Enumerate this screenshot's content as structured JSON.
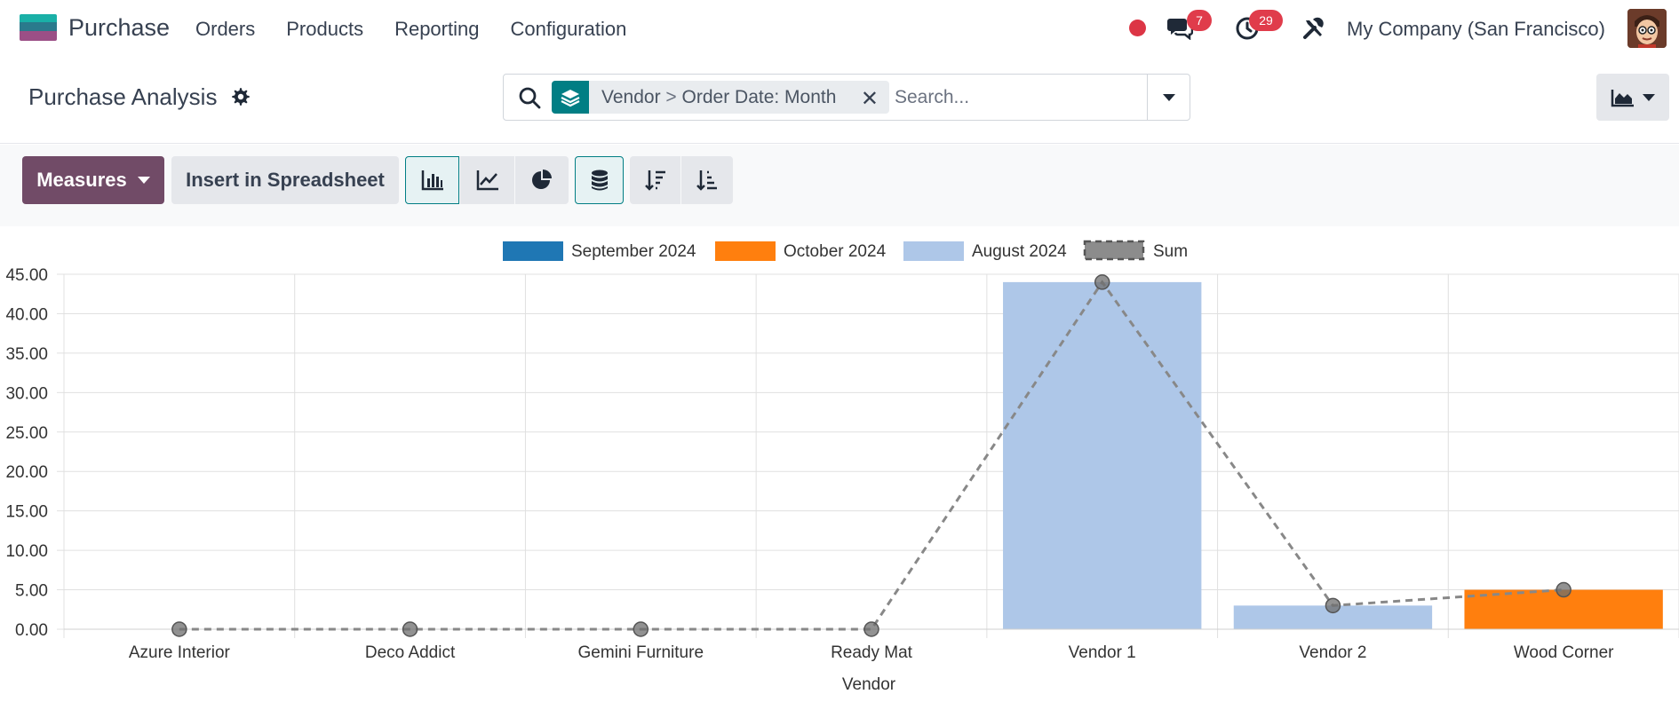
{
  "navbar": {
    "app_name": "Purchase",
    "menu": [
      {
        "label": "Orders"
      },
      {
        "label": "Products"
      },
      {
        "label": "Reporting"
      },
      {
        "label": "Configuration"
      }
    ],
    "chat_count": "7",
    "activity_count": "29",
    "company": "My Company (San Francisco)"
  },
  "control": {
    "title": "Purchase Analysis",
    "facet_group": "Vendor",
    "facet_sep": ">",
    "facet_sub": "Order Date: Month",
    "search_placeholder": "Search..."
  },
  "toolbar": {
    "measures_label": "Measures",
    "insert_label": "Insert in Spreadsheet"
  },
  "colors": {
    "primary": "#714b67",
    "accent": "#017e84",
    "september": "#1f77b4",
    "october": "#ff7f0e",
    "august": "#aec7e8",
    "sum": "#888888"
  },
  "chart_data": {
    "type": "bar",
    "stacked": true,
    "xlabel": "Vendor",
    "ylabel": "",
    "ylim": [
      0,
      45
    ],
    "yticks": [
      "0.00",
      "5.00",
      "10.00",
      "15.00",
      "20.00",
      "25.00",
      "30.00",
      "35.00",
      "40.00",
      "45.00"
    ],
    "categories": [
      "Azure Interior",
      "Deco Addict",
      "Gemini Furniture",
      "Ready Mat",
      "Vendor 1",
      "Vendor 2",
      "Wood Corner"
    ],
    "series": [
      {
        "name": "September 2024",
        "values": [
          0,
          0,
          0,
          0,
          0,
          0,
          0
        ]
      },
      {
        "name": "October 2024",
        "values": [
          0,
          0,
          0,
          0,
          0,
          0,
          5
        ]
      },
      {
        "name": "August 2024",
        "values": [
          0,
          0,
          0,
          0,
          44,
          3,
          0
        ]
      }
    ],
    "sum": {
      "name": "Sum",
      "values": [
        0,
        0,
        0,
        0,
        44,
        3,
        5
      ]
    },
    "legend": "top",
    "grid": true
  }
}
